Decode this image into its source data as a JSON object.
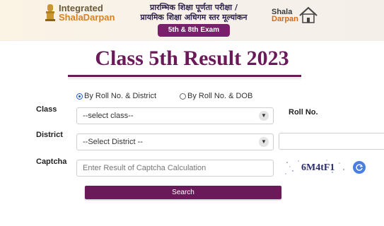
{
  "header": {
    "brand_line1": "Integrated",
    "brand_line2": "ShalaDarpan",
    "hindi_line1": "प्रारम्भिक शिक्षा पूर्णता परीक्षा /",
    "hindi_line2": "प्रायमिक शिक्षा अधिगम स्तर मूल्यांकन",
    "exam_badge": "5th & 8th Exam",
    "logo_line1": "Shala",
    "logo_line2": "Darpan"
  },
  "page_title": "Class 5th Result 2023",
  "search_mode": {
    "options": [
      {
        "label": "By Roll No. & District",
        "checked": true
      },
      {
        "label": "By Roll No. & DOB",
        "checked": false
      }
    ]
  },
  "form": {
    "class_label": "Class",
    "class_value": "--select class--",
    "district_label": "District",
    "district_value": "--Select District --",
    "roll_label": "Roll No.",
    "captcha_label": "Captcha",
    "captcha_placeholder": "Enter Result of Captcha Calculation",
    "captcha_text": "6M4tF1",
    "search_label": "Search"
  },
  "colors": {
    "accent": "#6b1a59",
    "badge": "#7a1f6b",
    "refresh": "#4a7fe0"
  },
  "icons": [
    "emblem-icon",
    "shaladarpan-logo-icon",
    "caret-down-icon",
    "refresh-icon"
  ]
}
